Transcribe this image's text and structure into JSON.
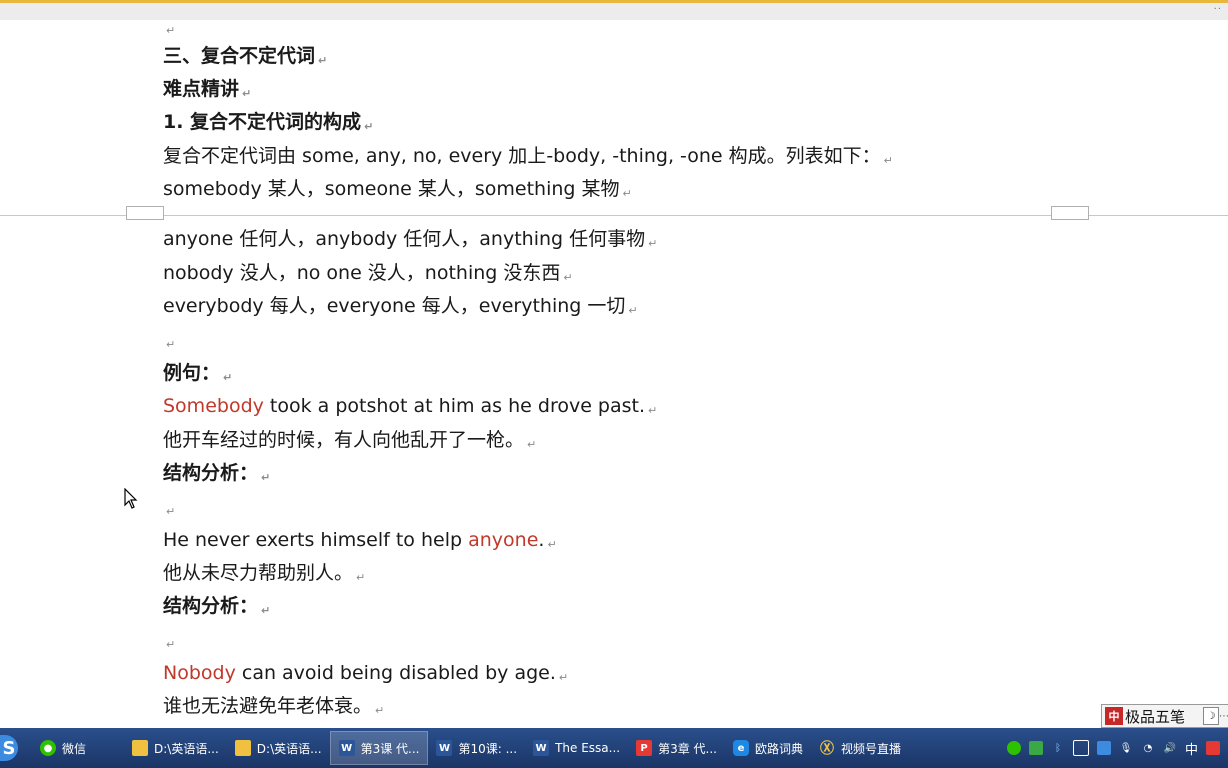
{
  "para_mark": "↵",
  "document": {
    "heading_section": "三、复合不定代词",
    "heading_sub": "难点精讲",
    "heading_item": "1. 复合不定代词的构成",
    "intro": "复合不定代词由 some, any, no, every 加上-body, -thing, -one 构成。列表如下：",
    "list_1": "somebody 某人，someone 某人，something 某物",
    "list_2": "anyone 任何人，anybody 任何人，anything 任何事物",
    "list_3": "nobody 没人，no one 没人，nothing 没东西",
    "list_4": "everybody 每人，everyone 每人，everything 一切",
    "examples_label": "例句：",
    "ex1_highlight": "Somebody",
    "ex1_rest": " took a potshot at him as he drove past.",
    "ex1_cn": "他开车经过的时候，有人向他乱开了一枪。",
    "analysis_label": "结构分析：",
    "ex2_pre": "He never exerts himself to help ",
    "ex2_highlight": "anyone",
    "ex2_post": ".",
    "ex2_cn": "他从未尽力帮助别人。",
    "ex3_highlight": "Nobody",
    "ex3_rest": " can avoid being disabled by age.",
    "ex3_cn": "谁也无法避免年老体衰。"
  },
  "ime": {
    "label": "极品五笔",
    "logo_glyph": "中",
    "moon_glyph": "☽"
  },
  "taskbar": {
    "start_glyph": "S",
    "items": [
      {
        "label": "微信",
        "icon": "wechat-icon"
      },
      {
        "label": "D:\\英语语...",
        "icon": "folder-icon"
      },
      {
        "label": "D:\\英语语...",
        "icon": "folder-icon"
      },
      {
        "label": "第3课 代...",
        "icon": "word-icon"
      },
      {
        "label": "第10课: ...",
        "icon": "word-icon"
      },
      {
        "label": "The Essa...",
        "icon": "word-icon"
      },
      {
        "label": "第3章 代...",
        "icon": "pdf-icon"
      },
      {
        "label": "欧路词典",
        "icon": "dictionary-icon"
      },
      {
        "label": "视频号直播",
        "icon": "video-icon"
      }
    ],
    "icon_glyphs": {
      "word": "W",
      "pdf": "P",
      "dict": "e"
    },
    "tray_lang": "中"
  },
  "colors": {
    "highlight": "#c0392b",
    "taskbar": "#1e3c72"
  }
}
